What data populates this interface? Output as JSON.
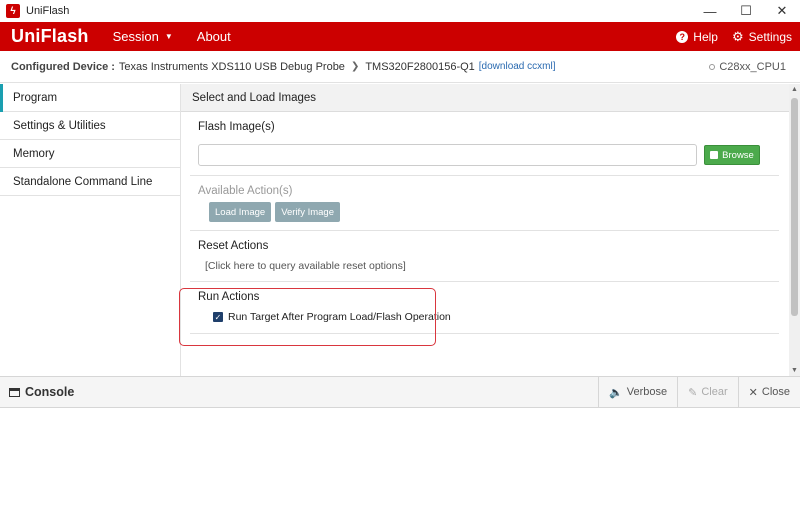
{
  "window": {
    "title": "UniFlash",
    "app_icon": "bolt-icon",
    "controls": [
      "—",
      "☐",
      "✕"
    ]
  },
  "navbar": {
    "brand": "UniFlash",
    "session": "Session",
    "about": "About",
    "help": "Help",
    "settings": "Settings",
    "accent": "#cc0000"
  },
  "device": {
    "label": "Configured Device :",
    "probe": "Texas Instruments XDS110 USB Debug Probe",
    "target": "TMS320F2800156-Q1",
    "download_link": "[download ccxml]",
    "core": "C28xx_CPU1"
  },
  "sidebar": {
    "items": [
      {
        "label": "Program"
      },
      {
        "label": "Settings & Utilities"
      },
      {
        "label": "Memory"
      },
      {
        "label": "Standalone Command Line"
      }
    ]
  },
  "main": {
    "header": "Select and Load Images",
    "flash_title": "Flash Image(s)",
    "flash_value": "",
    "browse_label": "Browse",
    "actions_title": "Available Action(s)",
    "load_image": "Load Image",
    "verify_image": "Verify Image",
    "reset_title": "Reset Actions",
    "reset_link": "[Click here to query available reset options]",
    "run_title": "Run Actions",
    "run_checkbox_label": "Run Target After Program Load/Flash Operation",
    "run_checked": true
  },
  "console": {
    "title": "Console",
    "verbose": "Verbose",
    "clear": "Clear",
    "close": "Close"
  }
}
